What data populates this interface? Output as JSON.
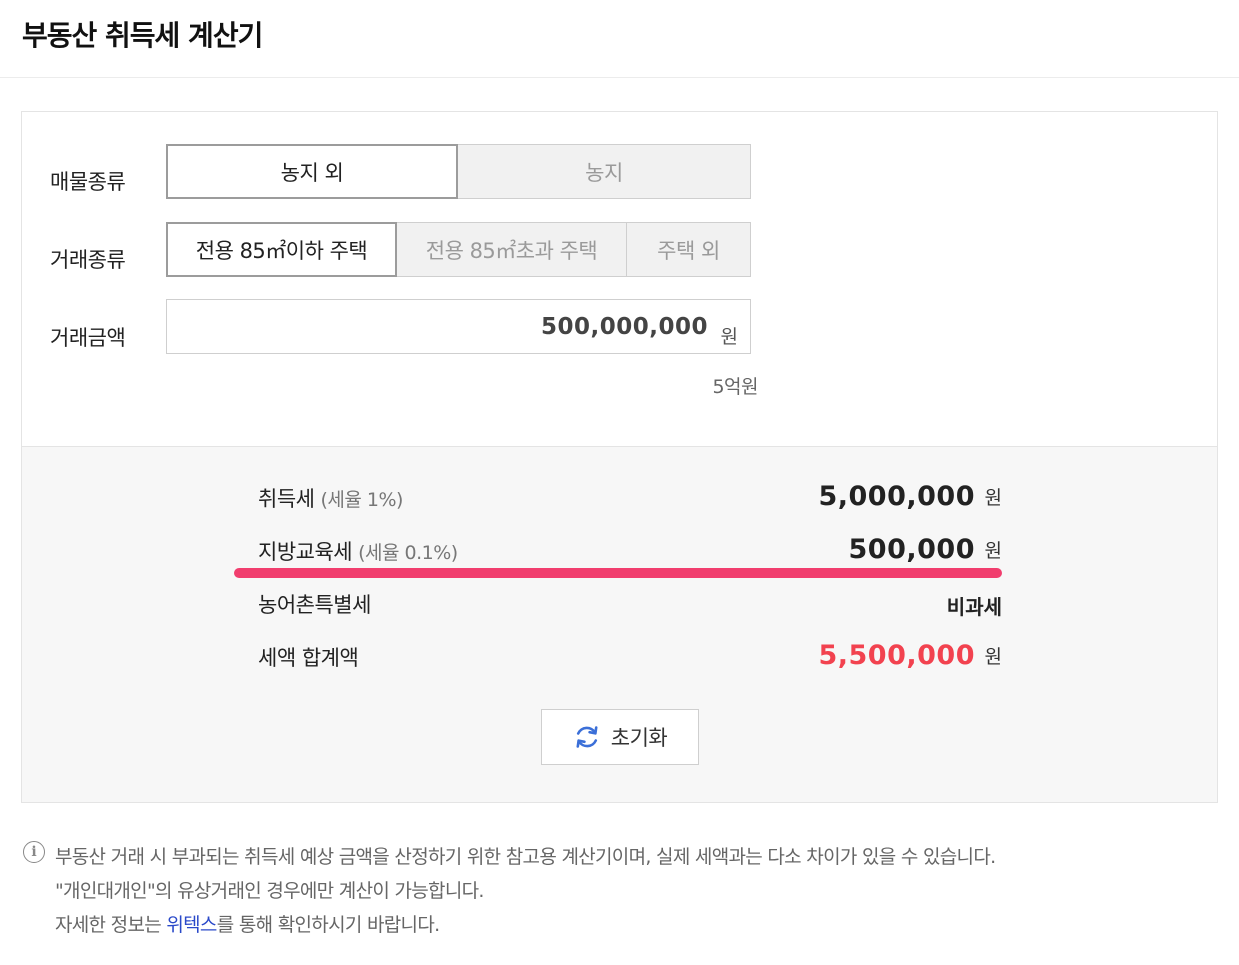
{
  "page": {
    "title": "부동산 취득세 계산기"
  },
  "form": {
    "property_type": {
      "label": "매물종류",
      "options": [
        "농지 외",
        "농지"
      ],
      "selected": 0
    },
    "deal_type": {
      "label": "거래종류",
      "options": [
        "전용 85㎡이하 주택",
        "전용 85㎡초과 주택",
        "주택 외"
      ],
      "selected": 0
    },
    "amount": {
      "label": "거래금액",
      "value": "500,000,000",
      "unit": "원",
      "korean": "5억원"
    }
  },
  "result": {
    "acquisition_tax": {
      "label": "취득세",
      "rate": "(세율 1%)",
      "value": "5,000,000",
      "unit": "원"
    },
    "education_tax": {
      "label": "지방교육세",
      "rate": "(세율 0.1%)",
      "value": "500,000",
      "unit": "원"
    },
    "rural_tax": {
      "label": "농어촌특별세",
      "value": "비과세"
    },
    "total": {
      "label": "세액 합계액",
      "value": "5,500,000",
      "unit": "원",
      "color": "#f2424f"
    },
    "reset_label": "초기화"
  },
  "notice": {
    "line1": "부동산 거래 시 부과되는 취득세 예상 금액을 산정하기 위한 참고용 계산기이며, 실제 세액과는 다소 차이가 있을 수 있습니다.",
    "line2": "\"개인대개인\"의 유상거래인 경우에만 계산이 가능합니다.",
    "line3_prefix": "자세한 정보는 ",
    "line3_link": "위텍스",
    "line3_suffix": "를 통해 확인하시기 바랍니다."
  },
  "colors": {
    "highlight": "#f13e6e",
    "link": "#2a49c9",
    "reset_icon": "#3b6fd8"
  },
  "icons": {
    "reset": "refresh-icon",
    "info": "info-icon"
  }
}
